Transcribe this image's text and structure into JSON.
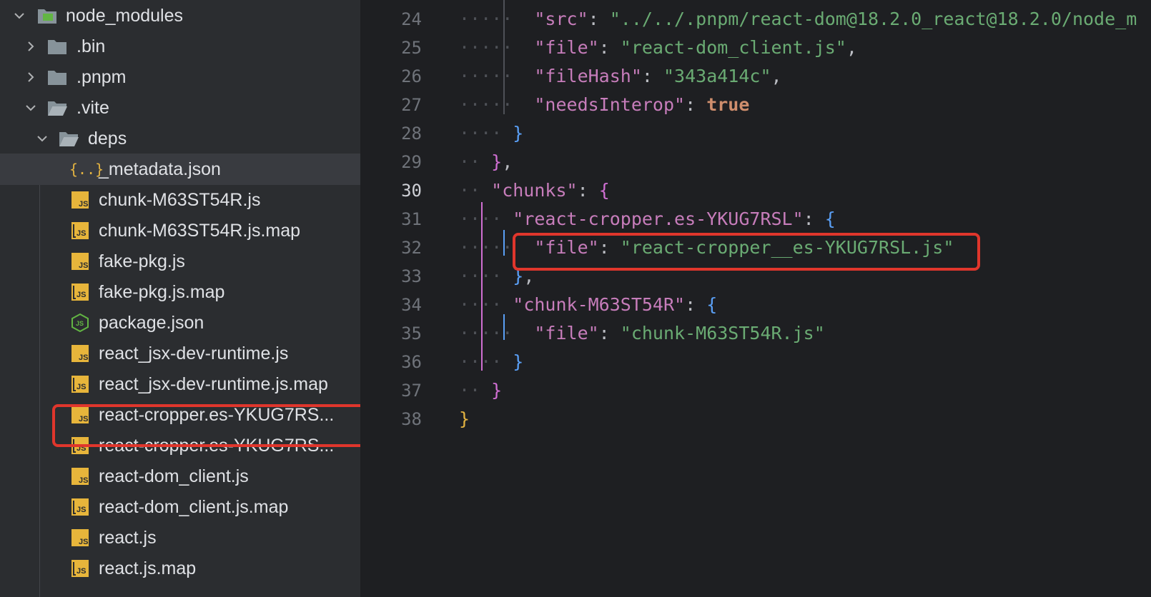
{
  "tree": {
    "items": [
      {
        "label": "node_modules",
        "icon": "folder-module-icon",
        "expanded": true
      },
      {
        "label": ".bin",
        "icon": "folder-icon",
        "expanded": false
      },
      {
        "label": ".pnpm",
        "icon": "folder-icon",
        "expanded": false
      },
      {
        "label": ".vite",
        "icon": "folder-icon",
        "expanded": true
      },
      {
        "label": "deps",
        "icon": "folder-icon",
        "expanded": true
      },
      {
        "label": "_metadata.json",
        "icon": "json-file-icon"
      },
      {
        "label": "chunk-M63ST54R.js",
        "icon": "js-file-icon"
      },
      {
        "label": "chunk-M63ST54R.js.map",
        "icon": "js-map-file-icon"
      },
      {
        "label": "fake-pkg.js",
        "icon": "js-file-icon"
      },
      {
        "label": "fake-pkg.js.map",
        "icon": "js-map-file-icon"
      },
      {
        "label": "package.json",
        "icon": "nodejs-icon"
      },
      {
        "label": "react_jsx-dev-runtime.js",
        "icon": "js-file-icon"
      },
      {
        "label": "react_jsx-dev-runtime.js.map",
        "icon": "js-map-file-icon"
      },
      {
        "label": "react-cropper.es-YKUG7RS...",
        "icon": "js-file-icon"
      },
      {
        "label": "react-cropper.es-YKUG7RS...",
        "icon": "js-map-file-icon"
      },
      {
        "label": "react-dom_client.js",
        "icon": "js-file-icon"
      },
      {
        "label": "react-dom_client.js.map",
        "icon": "js-map-file-icon"
      },
      {
        "label": "react.js",
        "icon": "js-file-icon"
      },
      {
        "label": "react.js.map",
        "icon": "js-map-file-icon"
      }
    ],
    "icon_text": {
      "json": "{..}",
      "js": "JS",
      "node": "JS"
    }
  },
  "editor": {
    "current_line": "30",
    "lines": [
      {
        "n": "24",
        "t": {
          "k": "\"src\"",
          "c": ": ",
          "s": "\"../../.pnpm/react-dom@18.2.0_react@18.2.0/node_m"
        }
      },
      {
        "n": "25",
        "t": {
          "k": "\"file\"",
          "c": ": ",
          "s": "\"react-dom_client.js\"",
          "e": ","
        }
      },
      {
        "n": "26",
        "t": {
          "k": "\"fileHash\"",
          "c": ": ",
          "s": "\"343a414c\"",
          "e": ","
        }
      },
      {
        "n": "27",
        "t": {
          "k": "\"needsInterop\"",
          "c": ": ",
          "kw": "true"
        }
      },
      {
        "n": "28",
        "t": {
          "b": "}"
        }
      },
      {
        "n": "29",
        "t": {
          "b": "}",
          "e": ","
        }
      },
      {
        "n": "30",
        "t": {
          "k": "\"chunks\"",
          "c": ": ",
          "b": "{"
        }
      },
      {
        "n": "31",
        "t": {
          "k": "\"react-cropper.es-YKUG7RSL\"",
          "c": ": ",
          "b": "{"
        }
      },
      {
        "n": "32",
        "t": {
          "k": "\"file\"",
          "c": ": ",
          "s": "\"react-cropper__es-YKUG7RSL.js\""
        }
      },
      {
        "n": "33",
        "t": {
          "b": "}",
          "e": ","
        }
      },
      {
        "n": "34",
        "t": {
          "k": "\"chunk-M63ST54R\"",
          "c": ": ",
          "b": "{"
        }
      },
      {
        "n": "35",
        "t": {
          "k": "\"file\"",
          "c": ": ",
          "s": "\"chunk-M63ST54R.js\""
        }
      },
      {
        "n": "36",
        "t": {
          "b": "}"
        }
      },
      {
        "n": "37",
        "t": {
          "b": "}"
        }
      },
      {
        "n": "38",
        "t": {
          "b": "}"
        }
      }
    ]
  },
  "colors": {
    "highlight": "#e0362c",
    "string": "#6aab73",
    "key": "#c77dbb",
    "keyword": "#cf8e6d"
  }
}
